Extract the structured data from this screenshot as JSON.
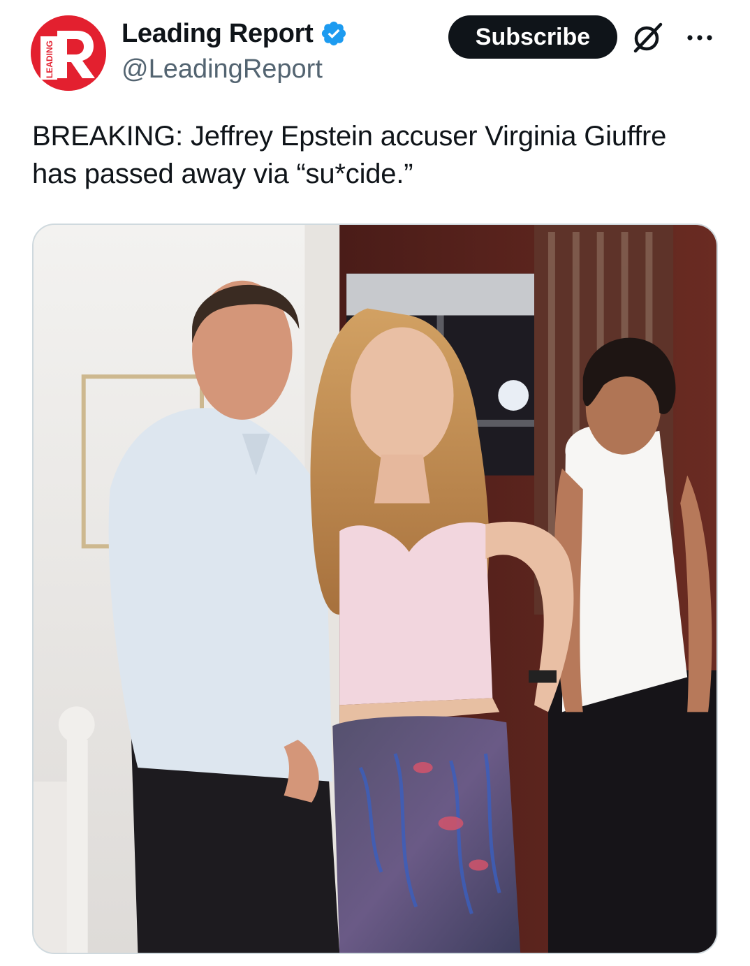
{
  "author": {
    "display_name": "Leading Report",
    "handle": "@LeadingReport",
    "verified": true,
    "avatar": {
      "icon": "leading-report-logo",
      "logo_text": "LEADING",
      "letter": "R",
      "color": "#e3202f"
    }
  },
  "actions": {
    "subscribe_label": "Subscribe",
    "grok_icon": "grok-icon",
    "more_icon": "more-icon"
  },
  "post": {
    "text": "BREAKING: Jeffrey Epstein accuser Virginia Giuffre has passed away via “su*cide.”"
  },
  "media": {
    "type": "photo",
    "people_count": 3
  },
  "colors": {
    "text_primary": "#0f1419",
    "text_secondary": "#536471",
    "verified": "#1d9bf0",
    "button_bg": "#0f1419",
    "brand_red": "#e3202f"
  }
}
